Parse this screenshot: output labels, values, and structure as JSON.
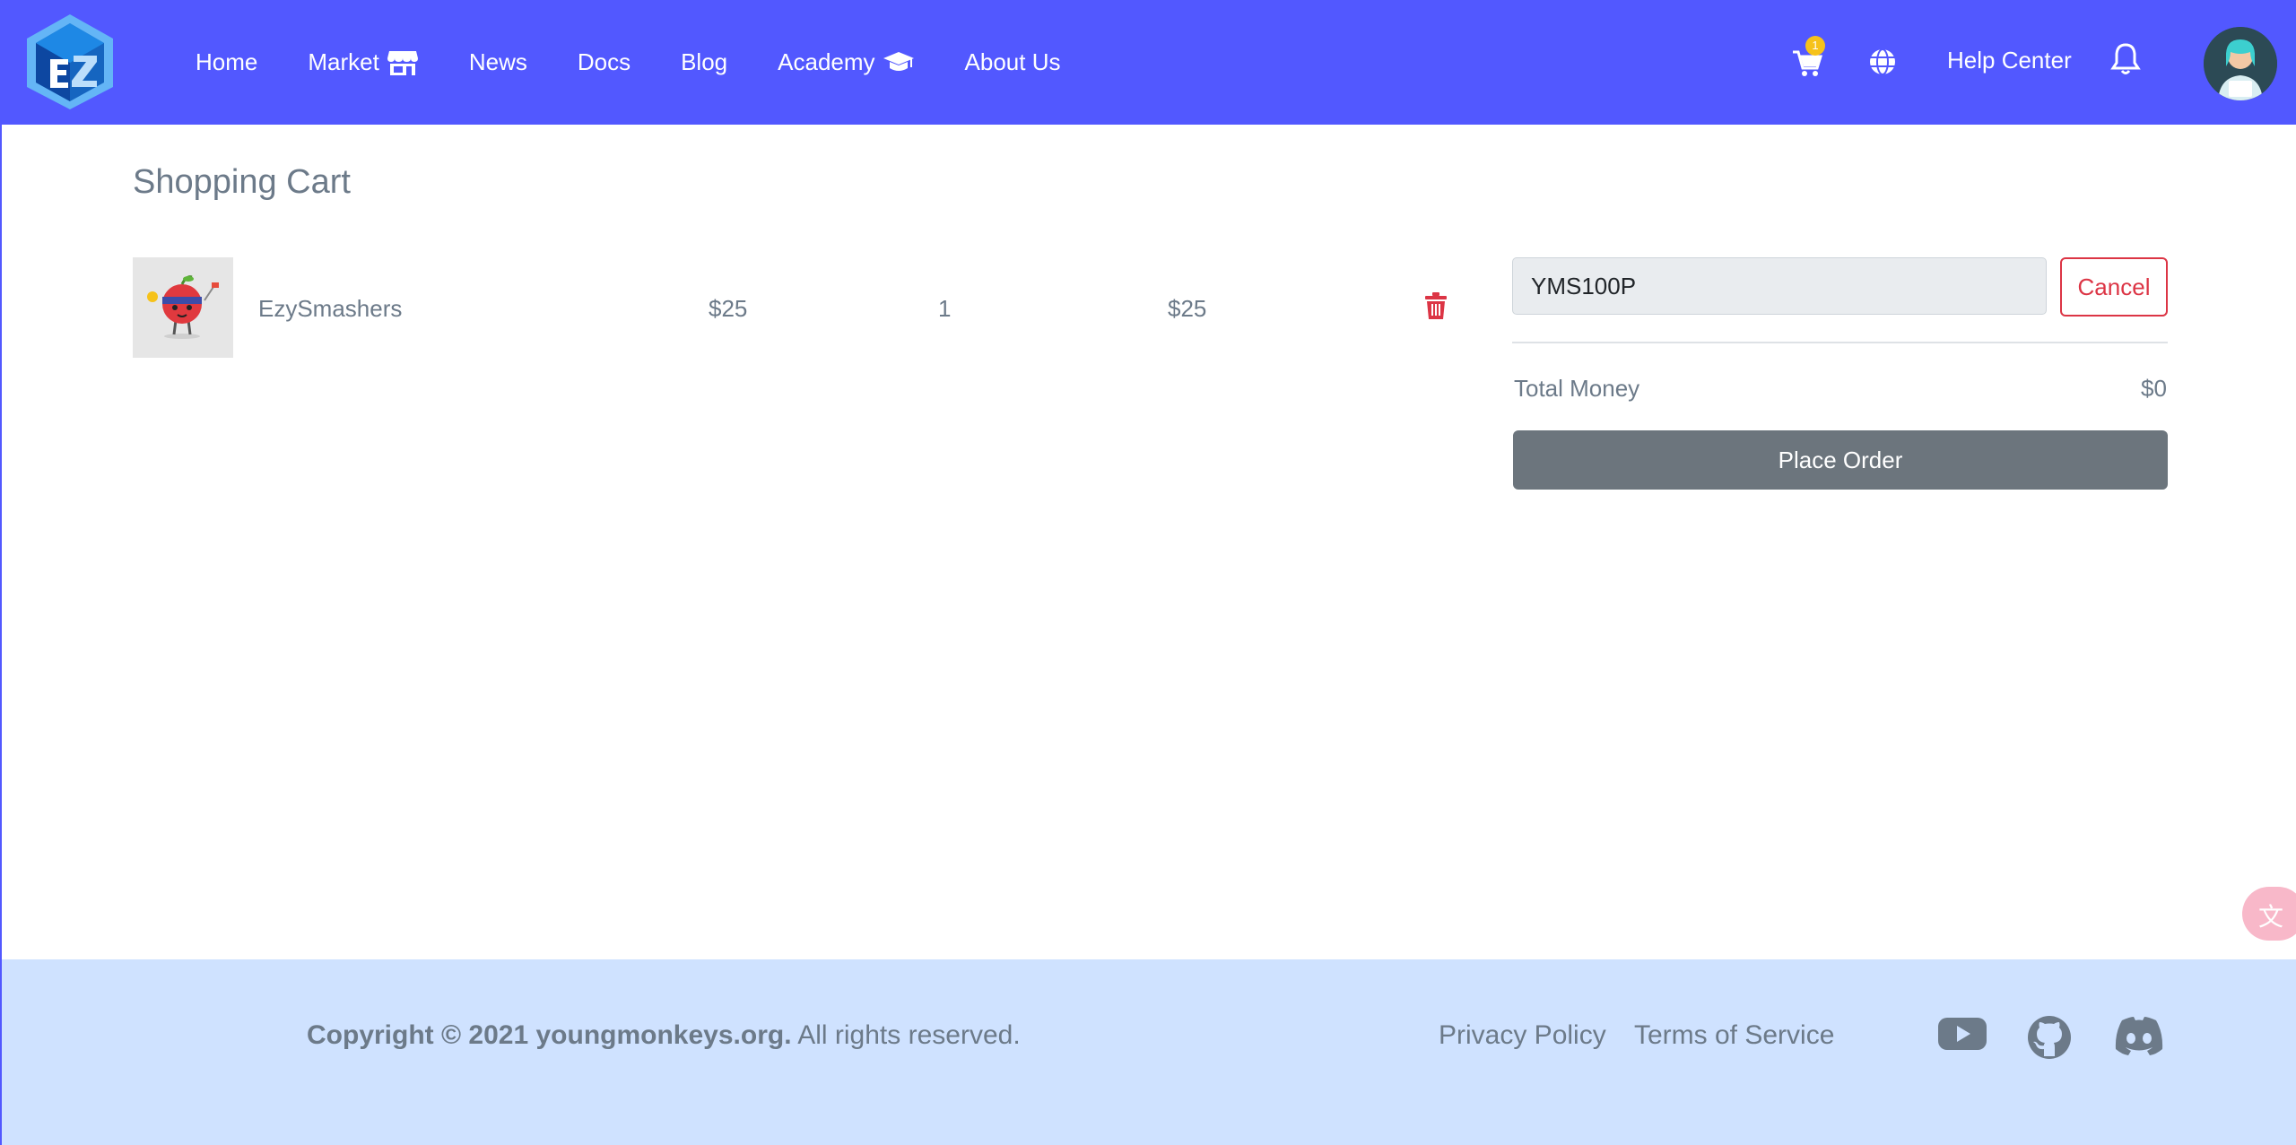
{
  "nav": {
    "logo_alt": "EZ",
    "items": [
      {
        "label": "Home"
      },
      {
        "label": "Market"
      },
      {
        "label": "News"
      },
      {
        "label": "Docs"
      },
      {
        "label": "Blog"
      },
      {
        "label": "Academy"
      },
      {
        "label": "About Us"
      }
    ],
    "cart_count": "1",
    "help_label": "Help Center"
  },
  "page": {
    "title": "Shopping Cart"
  },
  "cart": {
    "items": [
      {
        "name": "EzySmashers",
        "price": "$25",
        "quantity": "1",
        "subtotal": "$25"
      }
    ],
    "coupon_value": "YMS100P",
    "cancel_label": "Cancel",
    "total_label": "Total Money",
    "total_value": "$0",
    "place_order_label": "Place Order"
  },
  "footer": {
    "copyright_bold": "Copyright © 2021 youngmonkeys.org.",
    "copyright_rest": " All rights reserved.",
    "privacy_label": "Privacy Policy",
    "terms_label": "Terms of Service",
    "social_icons": [
      "youtube-icon",
      "github-icon",
      "discord-icon"
    ]
  },
  "colors": {
    "navbar": "#5258ff",
    "footer": "#cfe2ff",
    "danger": "#dc3545",
    "secondary": "#6c757d",
    "badge": "#f6c21a"
  }
}
